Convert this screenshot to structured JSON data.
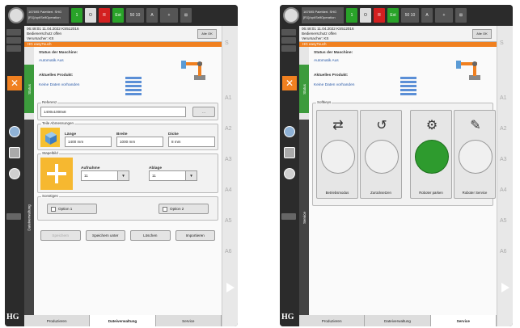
{
  "left": {
    "topbar": {
      "cell_info_line1": "167695 Palettiert. SHG",
      "cell_info_line2": "[R1]/opt/SelfOperation",
      "green_label": "1",
      "o_label": "O",
      "red_label": "R",
      "ext_label": "Ext",
      "speed_label": "50 10",
      "auto_label": "A",
      "io_label": "+",
      "menu_label": "⊞"
    },
    "message": {
      "line1": "06:48:01 11.04.2022 KS512016",
      "line2": "Bedienerschutz offen",
      "line3": "Verursacher: KS",
      "alle_ok": "Alle OK"
    },
    "hmi_bar": "HG easyTouch",
    "vtabs": {
      "status": "Status",
      "dateiverwaltung": "Dateiverwaltung"
    },
    "status": {
      "machine_label": "Status der Maschine:",
      "machine_value": "Automatik Aus",
      "product_label": "Aktuelles Produkt:",
      "product_value": "Keine Daten vorhanden"
    },
    "referenz": {
      "label": "Referenz",
      "value": "1400x1000x8",
      "btn": "..."
    },
    "dimensions": {
      "title": "Teile Abmessungen",
      "laenge_label": "Länge",
      "laenge_value": "1400 mm",
      "breite_label": "Breite",
      "breite_value": "1000 mm",
      "dicke_label": "Dicke",
      "dicke_value": "8 mm"
    },
    "stapel": {
      "title": "Stapelbild",
      "aufnahme_label": "Aufnahme",
      "aufnahme_value": "11",
      "ablage_label": "Ablage",
      "ablage_value": "11"
    },
    "sonstiges": {
      "title": "Sonstiges",
      "option1": "Option 1",
      "option2": "Option 2"
    },
    "actions": {
      "speichern": "Speichern",
      "speichern_unter": "Speichern unter",
      "loeschen": "Löschen",
      "importieren": "Importieren"
    },
    "bottom_tabs": [
      "Produzieren",
      "Dateiverwaltung",
      "Service"
    ],
    "active_tab": "Dateiverwaltung",
    "right_rail": [
      "S",
      "A1",
      "A2",
      "A3",
      "A4",
      "A5",
      "A6"
    ],
    "logo": "HG"
  },
  "right": {
    "topbar": {
      "cell_info_line1": "167695 Palettiert. SHG",
      "cell_info_line2": "[R1]/opt/SelfOperation",
      "green_label": "1",
      "o_label": "O",
      "red_label": "R",
      "ext_label": "Ext",
      "speed_label": "50 10",
      "auto_label": "A",
      "io_label": "+",
      "menu_label": "⊞"
    },
    "message": {
      "line1": "06:48:01 11.04.2022 KS512016",
      "line2": "Bedienerschutz offen",
      "line3": "Verursacher: KS",
      "alle_ok": "Alle OK"
    },
    "hmi_bar": "HG easyTouch",
    "vtabs": {
      "status": "Status",
      "service": "Service"
    },
    "status": {
      "machine_label": "Status der Maschine:",
      "machine_value": "Automatik Aus",
      "product_label": "Aktuelles Produkt:",
      "product_value": "Keine Daten vorhanden"
    },
    "softkeys": {
      "title": "Softkeys",
      "items": [
        {
          "label": "Betriebsmodus",
          "icon": "swap-arrows-icon",
          "glyph": "⇄",
          "on": false
        },
        {
          "label": "Zurücksetzen",
          "icon": "undo-icon",
          "glyph": "↺",
          "on": false
        },
        {
          "label": "Roboter parken",
          "icon": "robot-park-icon",
          "glyph": "⚙",
          "on": true
        },
        {
          "label": "Roboter Service",
          "icon": "wrench-icon",
          "glyph": "✎",
          "on": false
        }
      ]
    },
    "bottom_tabs": [
      "Produzieren",
      "Dateiverwaltung",
      "Service"
    ],
    "active_tab": "Service",
    "right_rail": [
      "S",
      "A1",
      "A2",
      "A3",
      "A4",
      "A5",
      "A6"
    ],
    "logo": "HG"
  }
}
